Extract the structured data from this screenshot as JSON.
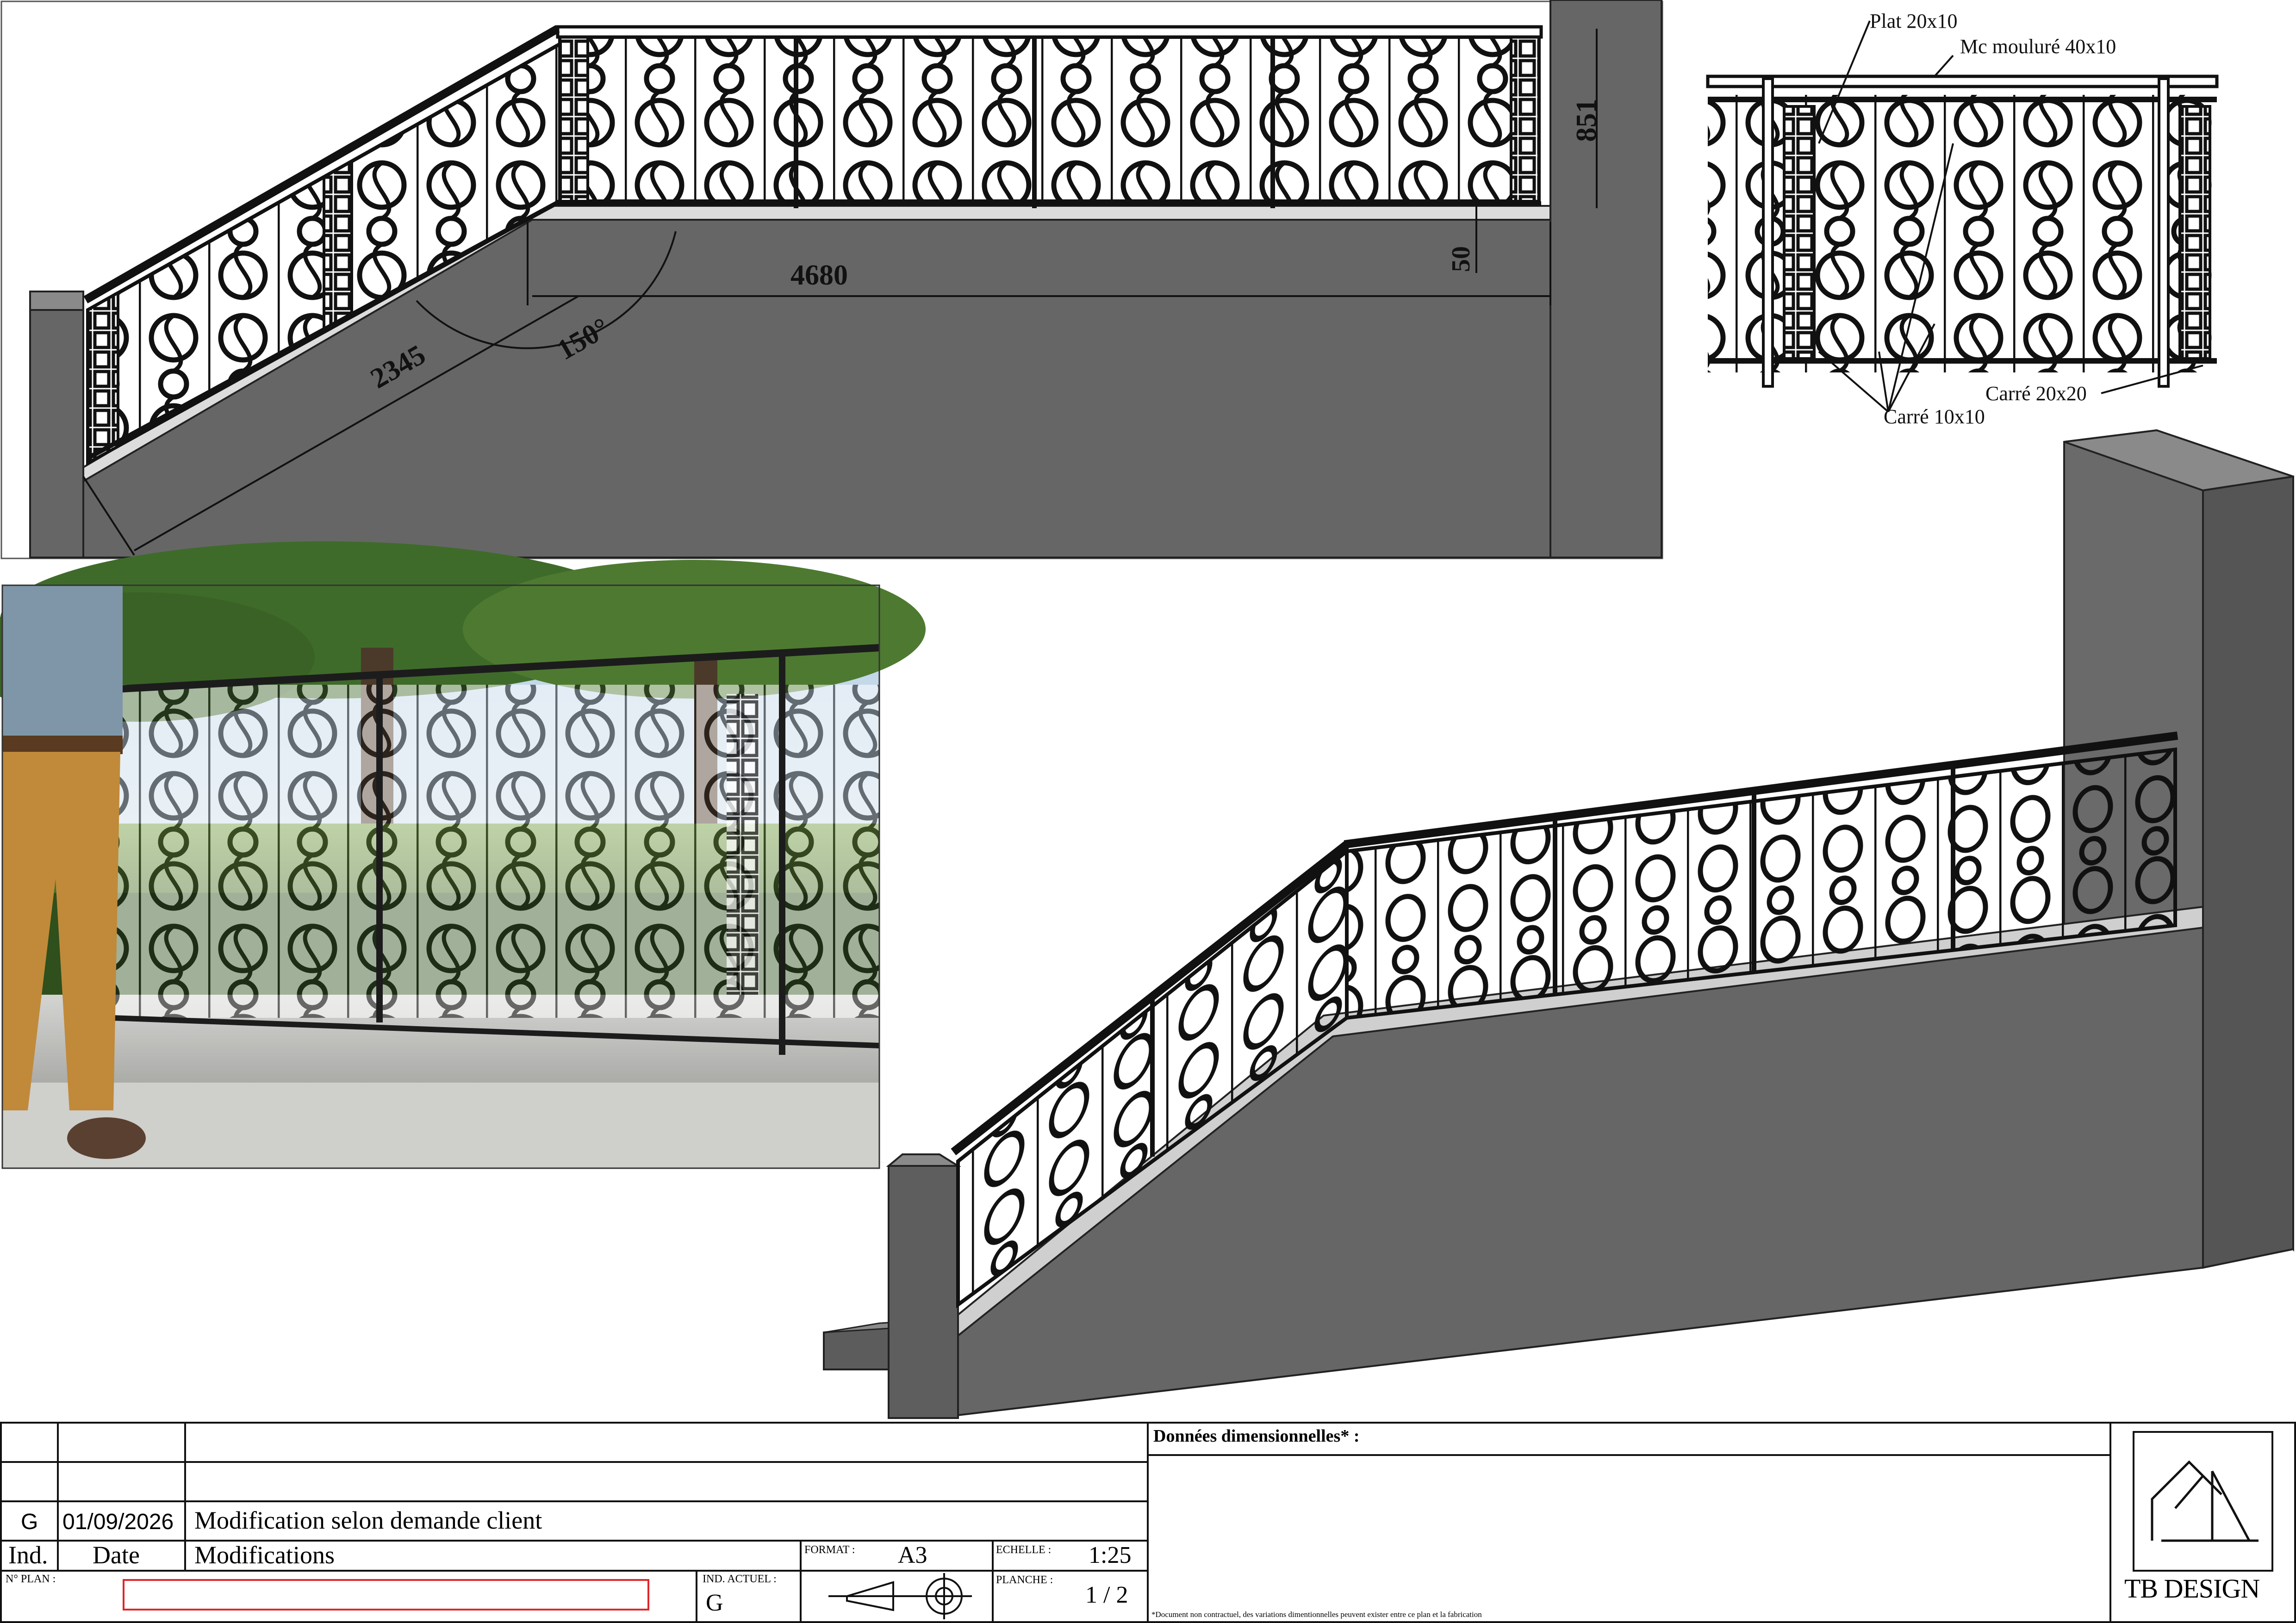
{
  "dims": {
    "height": "851",
    "top_gap": "50",
    "length": "4680",
    "slope": "2345",
    "angle": "150°"
  },
  "callouts": {
    "plat": "Plat 20x10",
    "main_courante": "Mc mouluré 40x10",
    "carre_large": "Carré 20x20",
    "carre_small": "Carré 10x10"
  },
  "title_block": {
    "revision": {
      "ind": "G",
      "date": "01/09/2026",
      "modification": "Modification selon demande client"
    },
    "headers": {
      "ind": "Ind.",
      "date": "Date",
      "modifications": "Modifications"
    },
    "no_plan_label": "N° PLAN :",
    "no_plan_value": "",
    "ind_actuel_label": "IND. ACTUEL :",
    "ind_actuel_value": "G",
    "format_label": "FORMAT :",
    "format_value": "A3",
    "echelle_label": "ECHELLE :",
    "echelle_value": "1:25",
    "planche_label": "PLANCHE :",
    "planche_value": "1 / 2",
    "donnees_label": "Données dimensionnelles* :",
    "disclaimer": "*Document non contractuel, des variations dimentionnelles peuvent exister entre ce plan et la fabrication",
    "brand": "TB DESIGN"
  },
  "colors": {
    "wall": "#666666",
    "wall_dark": "#4c4c4c",
    "metal": "#1a1a1a",
    "accent_red": "#e0262a"
  }
}
